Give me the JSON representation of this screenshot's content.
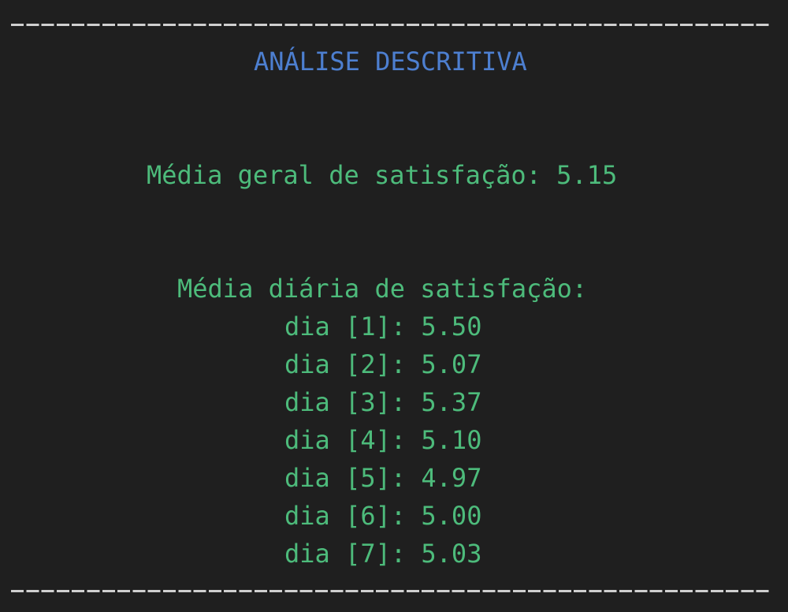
{
  "terminal": {
    "separator": "-------------------------------------------------------------",
    "title": "ANÁLISE DESCRITIVA",
    "overall_line": "Média geral de satisfação: 5.15",
    "daily_header": "Média diária de satisfação:",
    "days": [
      "dia [1]: 5.50",
      "dia [2]: 5.07",
      "dia [3]: 5.37",
      "dia [4]: 5.10",
      "dia [5]: 4.97",
      "dia [6]: 5.00",
      "dia [7]: 5.03"
    ]
  },
  "colors": {
    "background": "#1f1f1f",
    "title": "#4d7fd0",
    "text": "#4dbb7b",
    "separator": "#cfcfcf"
  }
}
